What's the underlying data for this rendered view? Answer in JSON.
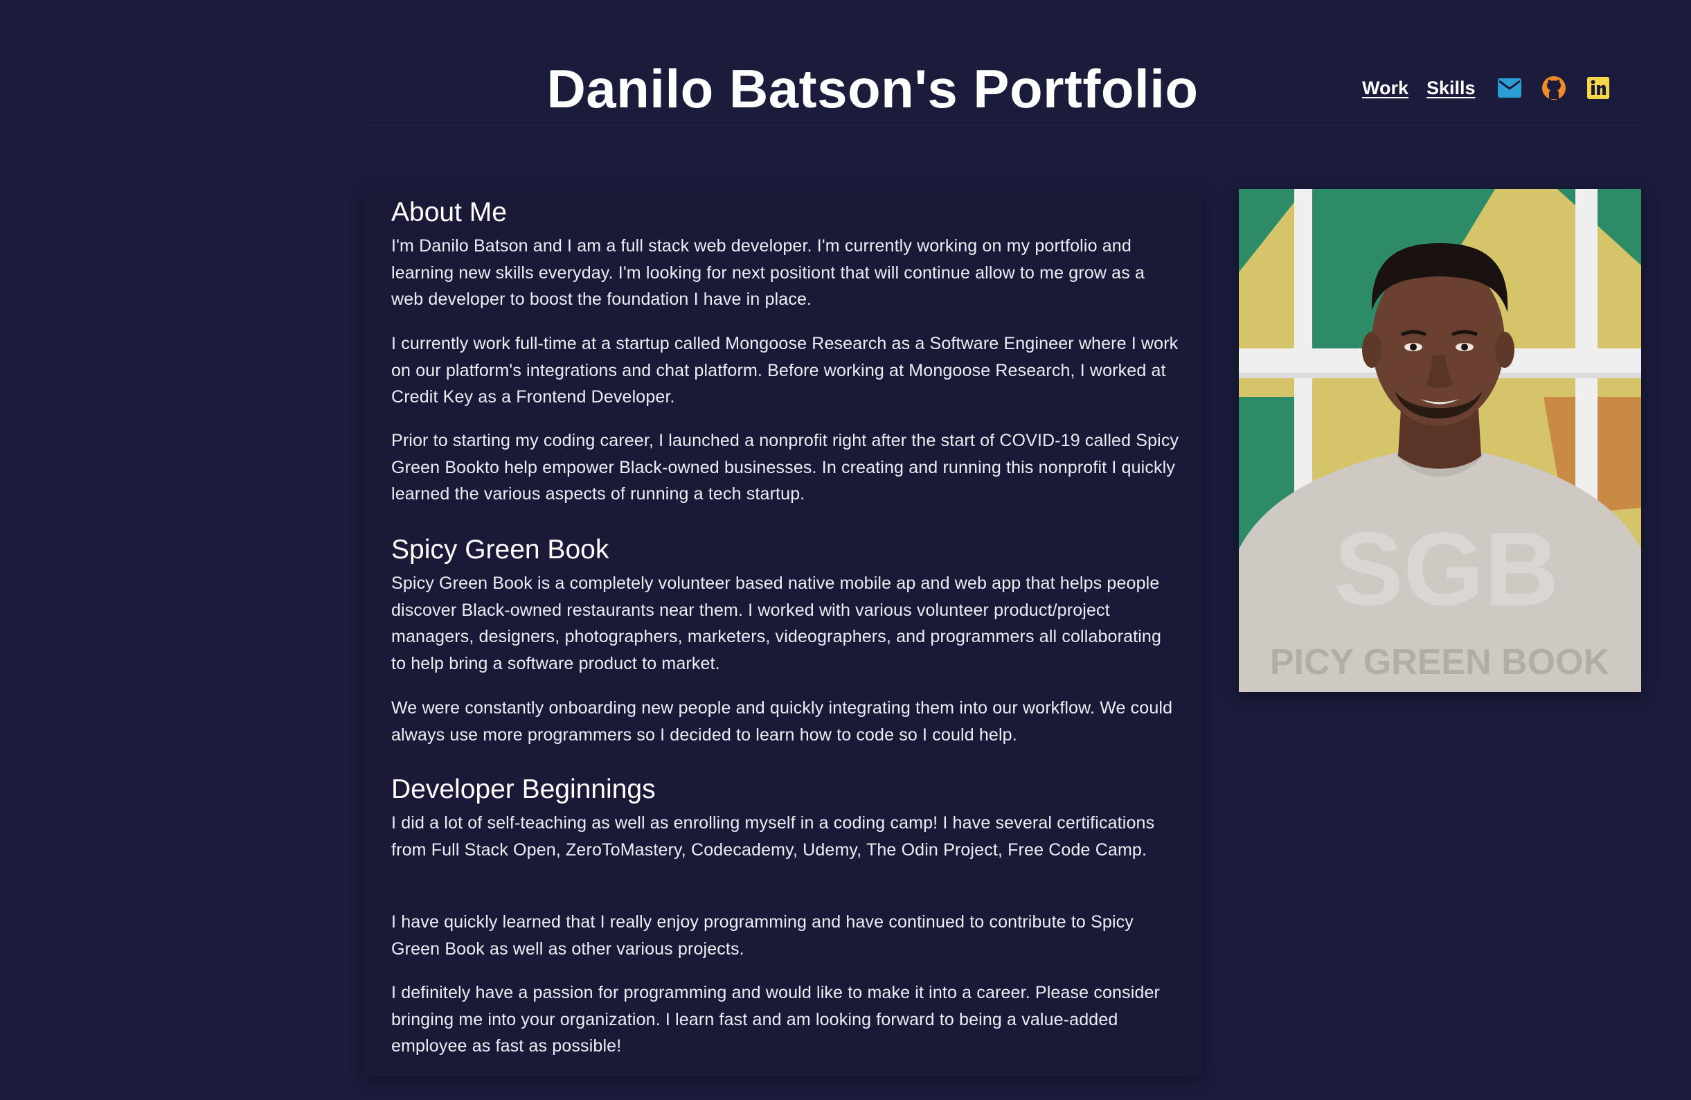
{
  "header": {
    "title": "Danilo Batson's Portfolio",
    "nav": {
      "work_label": "Work",
      "skills_label": "Skills"
    },
    "icons": {
      "email": {
        "name": "mail-icon",
        "color": "#2a9fd6"
      },
      "github": {
        "name": "github-icon",
        "color": "#f08a24"
      },
      "linkedin": {
        "name": "linkedin-icon",
        "color": "#f5d74a"
      }
    }
  },
  "about": {
    "heading": "About Me",
    "paragraphs": [
      "I'm Danilo Batson and I am a full stack web developer. I'm currently working on my portfolio and learning new skills everyday. I'm looking for next positiont that will continue allow to me grow as a web developer to boost the foundation I have in place.",
      "I currently work full-time at a startup called Mongoose Research as a Software Engineer where I work on our platform's integrations and chat platform. Before working at Mongoose Research, I worked at Credit Key as a Frontend Developer.",
      "Prior to starting my coding career, I launched a nonprofit right after the start of COVID-19 called Spicy Green Bookto help empower Black-owned businesses. In creating and running this nonprofit I quickly learned the various aspects of running a tech startup."
    ]
  },
  "spicy": {
    "heading": "Spicy Green Book",
    "paragraphs": [
      "Spicy Green Book is a completely volunteer based native mobile ap and web app that helps people discover Black-owned restaurants near them. I worked with various volunteer product/project managers, designers, photographers, marketers, videographers, and programmers all collaborating to help bring a software product to market.",
      "We were constantly onboarding new people and quickly integrating them into our workflow. We could always use more programmers so I decided to learn how to code so I could help."
    ]
  },
  "beginnings": {
    "heading": "Developer Beginnings",
    "paragraphs": [
      "I did a lot of self-teaching as well as enrolling myself in a coding camp! I have several certifications from Full Stack Open, ZeroToMastery, Codecademy, Udemy, The Odin Project, Free Code Camp.",
      "I have quickly learned that I really enjoy programming and have continued to contribute to Spicy Green Book as well as other various projects.",
      "I definitely have a passion for programming and would like to make it into a career. Please consider bringing me into your organization. I learn fast and am looking forward to being a value-added employee as fast as possible!"
    ]
  },
  "photo": {
    "shirt_text": "PICY GREEN BOOK",
    "colors": {
      "background": "#1b1c3c",
      "wall_green": "#2e8b68",
      "wall_yellow": "#d6c46a",
      "frame_white": "#efefef",
      "shirt": "#cfc9c4",
      "skin": "#6a4030"
    }
  }
}
